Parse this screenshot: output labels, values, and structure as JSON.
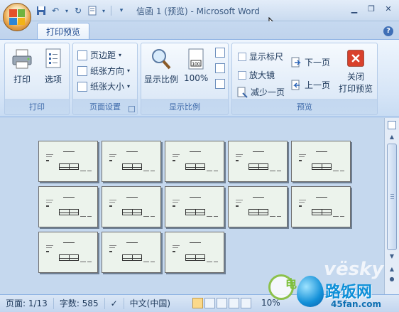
{
  "window": {
    "title": "信函 1 (预览) - Microsoft Word",
    "controls": [
      "minimize-icon",
      "restore-icon",
      "close-icon"
    ]
  },
  "ribbon": {
    "tab_label": "打印预览",
    "groups": {
      "print": {
        "label": "打印",
        "print_btn": "打印",
        "options_btn": "选项"
      },
      "page_setup": {
        "label": "页面设置",
        "margins": "页边距",
        "orientation": "纸张方向",
        "size": "纸张大小"
      },
      "zoom": {
        "label": "显示比例",
        "zoom_btn": "显示比例",
        "hundred_btn": "100%"
      },
      "preview": {
        "label": "预览",
        "show_ruler": "显示标尺",
        "magnifier": "放大镜",
        "shrink": "减少一页",
        "next": "下一页",
        "prev": "上一页",
        "close_line1": "关闭",
        "close_line2": "打印预览"
      }
    }
  },
  "status": {
    "page": "页面: 1/13",
    "words": "字数: 585",
    "language": "中文(中国)",
    "zoom": "10%"
  },
  "pages": {
    "count": 13,
    "per_row": 5
  },
  "watermarks": {
    "vesky": "vësky",
    "dian": "电",
    "brand": "路饭网",
    "url": "45fan.com"
  },
  "colors": {
    "accent": "#15428b",
    "ribbon_bg": "#dde9f7",
    "workspace_bg": "#c5d8ee",
    "close_red": "#d9412c"
  }
}
